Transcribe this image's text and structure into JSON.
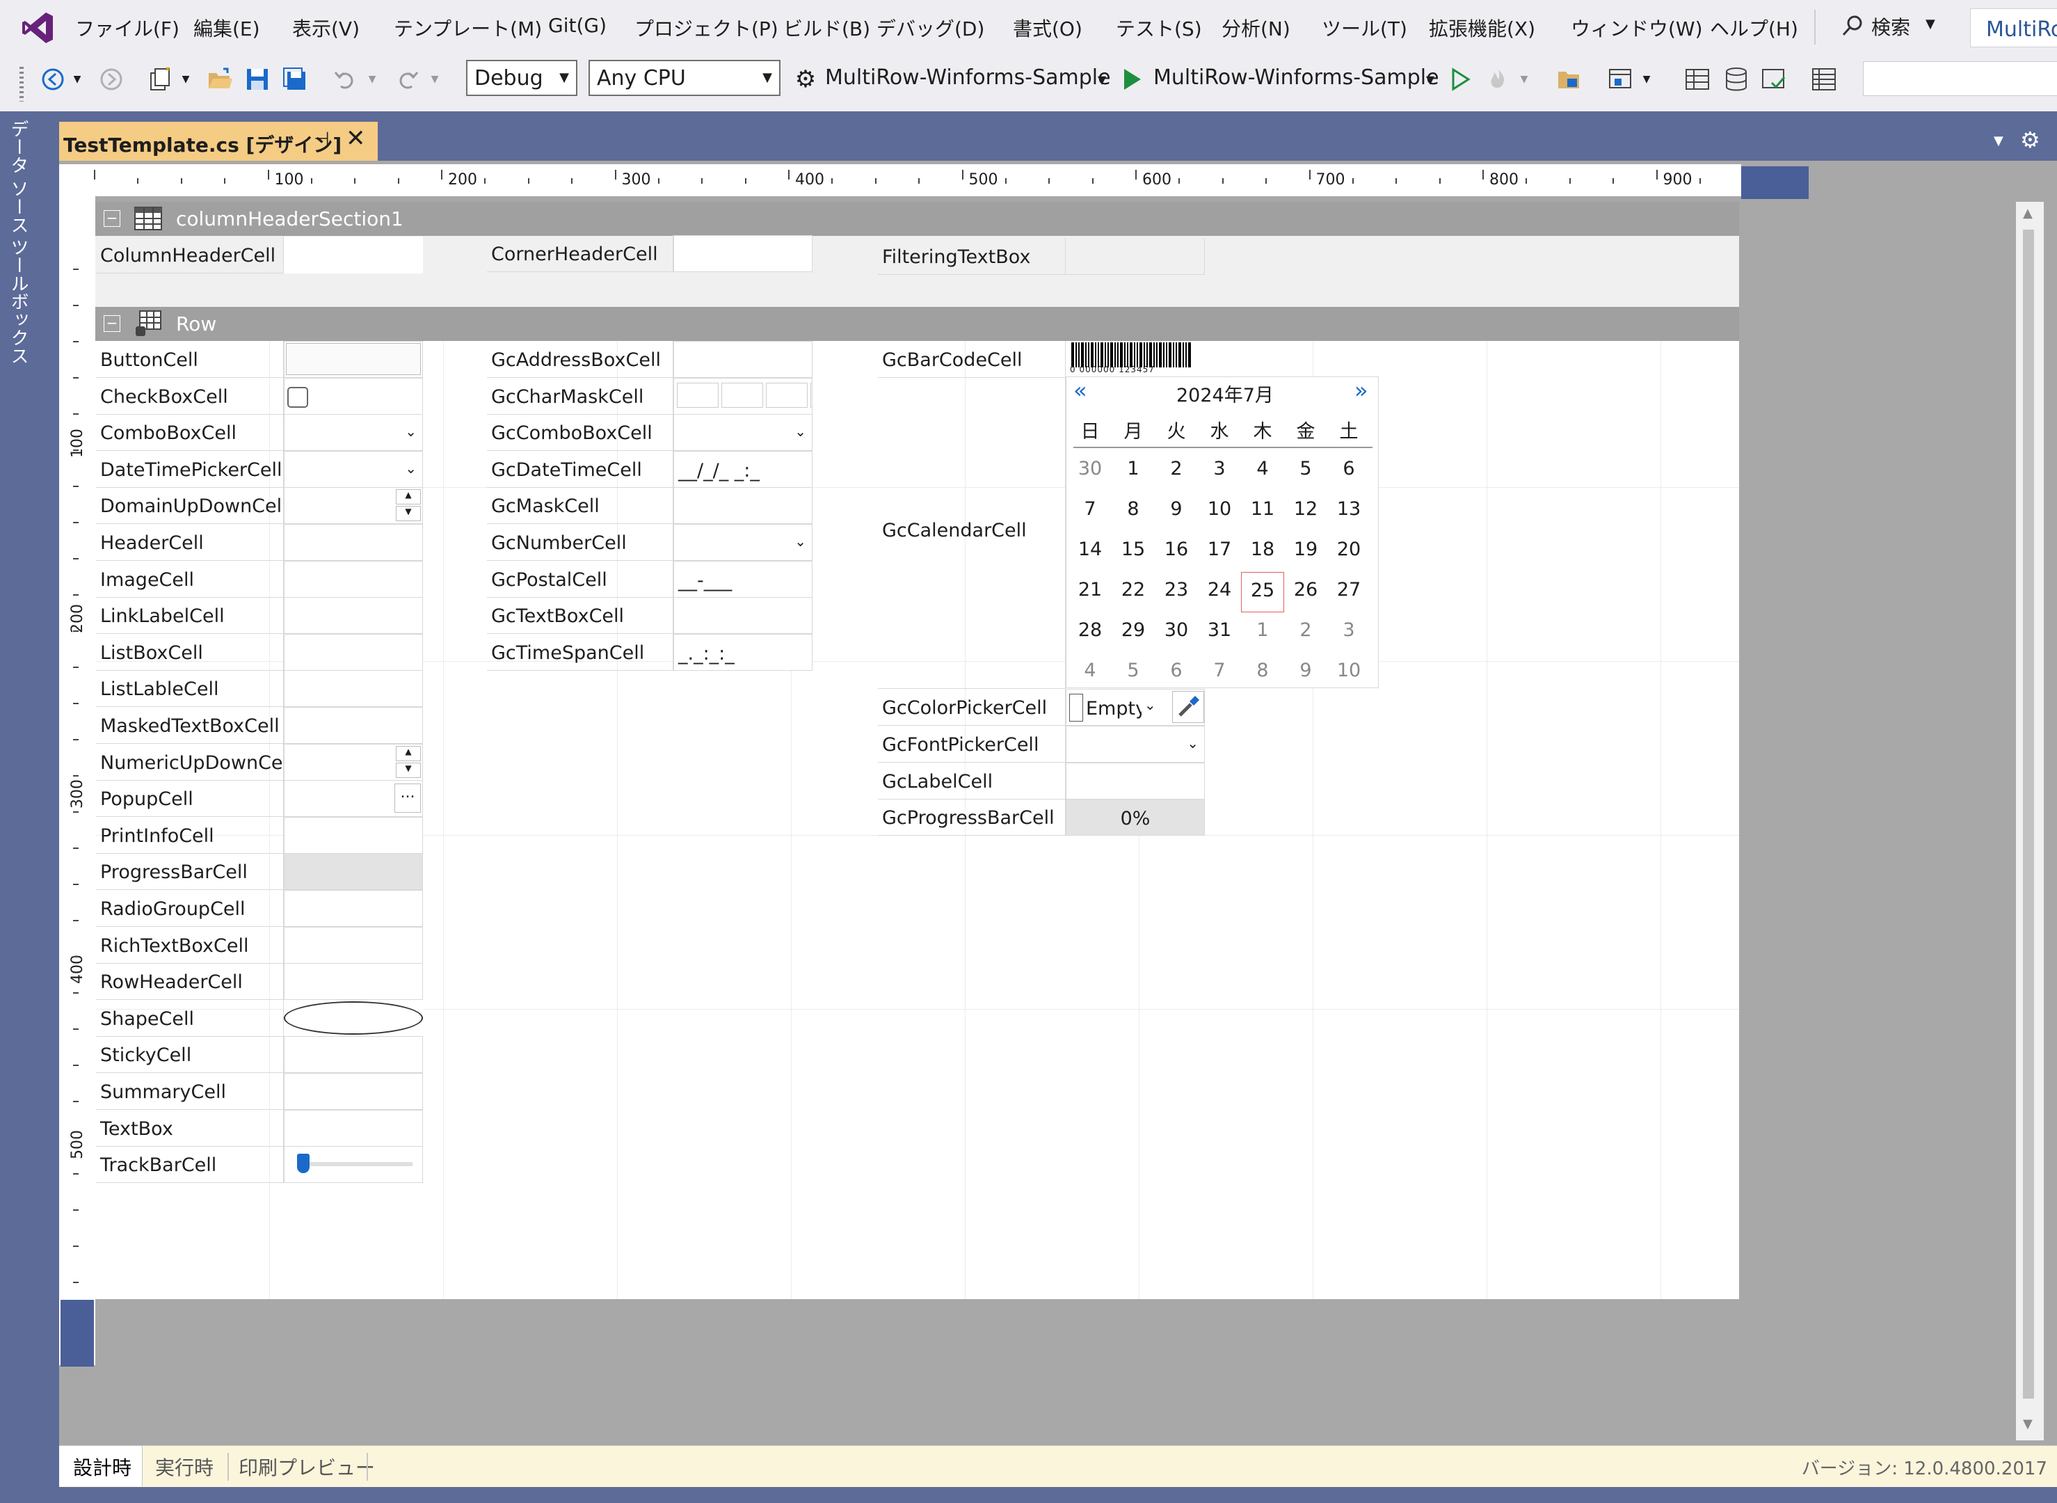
{
  "menu": [
    "ファイル(F)",
    "編集(E)",
    "表示(V)",
    "テンプレート(M)",
    "Git(G)",
    "プロジェクト(P)",
    "ビルド(B)",
    "デバッグ(D)",
    "書式(O)",
    "テスト(S)",
    "分析(N)",
    "ツール(T)",
    "拡張機能(X)",
    "ウィンドウ(W)",
    "ヘルプ(H)"
  ],
  "search_label": "検索",
  "solution_name": "MultiRo",
  "toolbar": {
    "config": "Debug",
    "platform": "Any CPU",
    "startup_project": "MultiRow-Winforms-Sample",
    "run_target": "MultiRow-Winforms-Sample"
  },
  "side_tabs": [
    "データ ソース",
    "ツールボックス"
  ],
  "document_tab": {
    "title": "TestTemplate.cs [デザイン]"
  },
  "ruler": {
    "top": [
      "100",
      "200",
      "300",
      "400",
      "500",
      "600",
      "700",
      "800",
      "900"
    ],
    "left": [
      "100",
      "200",
      "300",
      "400",
      "500"
    ]
  },
  "header_section": {
    "name": "columnHeaderSection1",
    "cells": [
      "ColumnHeaderCell",
      "CornerHeaderCell",
      "FilteringTextBox"
    ]
  },
  "row_section": {
    "name": "Row",
    "col1": [
      "ButtonCell",
      "CheckBoxCell",
      "ComboBoxCell",
      "DateTimePickerCell",
      "DomainUpDownCell",
      "HeaderCell",
      "ImageCell",
      "LinkLabelCell",
      "ListBoxCell",
      "ListLableCell",
      "MaskedTextBoxCell",
      "NumericUpDownCell",
      "PopupCell",
      "PrintInfoCell",
      "ProgressBarCell",
      "RadioGroupCell",
      "RichTextBoxCell",
      "RowHeaderCell",
      "ShapeCell",
      "StickyCell",
      "SummaryCell",
      "TextBox",
      "TrackBarCell"
    ],
    "col2": [
      "GcAddressBoxCell",
      "GcCharMaskCell",
      "GcComboBoxCell",
      "GcDateTimeCell",
      "GcMaskCell",
      "GcNumberCell",
      "GcPostalCell",
      "GcTextBoxCell",
      "GcTimeSpanCell"
    ],
    "col2_values": {
      "datetime": "__/_/_ _:_",
      "postal": "__-___",
      "timespan": "_._:_:_"
    },
    "col3": [
      "GcBarCodeCell",
      "GcCalendarCell",
      "GcColorPickerCell",
      "GcFontPickerCell",
      "GcLabelCell",
      "GcProgressBarCell"
    ],
    "barcode_digits": "0 000000 123457",
    "color_value": "Empty",
    "progress_value": "0%",
    "popup_button": "..."
  },
  "calendar": {
    "title": "2024年7月",
    "prev": "«",
    "next": "»",
    "weekdays": [
      "日",
      "月",
      "火",
      "水",
      "木",
      "金",
      "土"
    ],
    "weeks": [
      [
        "30",
        "1",
        "2",
        "3",
        "4",
        "5",
        "6"
      ],
      [
        "7",
        "8",
        "9",
        "10",
        "11",
        "12",
        "13"
      ],
      [
        "14",
        "15",
        "16",
        "17",
        "18",
        "19",
        "20"
      ],
      [
        "21",
        "22",
        "23",
        "24",
        "25",
        "26",
        "27"
      ],
      [
        "28",
        "29",
        "30",
        "31",
        "1",
        "2",
        "3"
      ],
      [
        "4",
        "5",
        "6",
        "7",
        "8",
        "9",
        "10"
      ]
    ],
    "today": "25"
  },
  "status_tabs": [
    "設計時",
    "実行時",
    "印刷プレビュー"
  ],
  "version": "バージョン: 12.0.4800.2017",
  "colors": {
    "accent": "#68217a",
    "tab": "#f5cc84",
    "frame": "#5d6b99",
    "run": "#1e8e3e"
  }
}
